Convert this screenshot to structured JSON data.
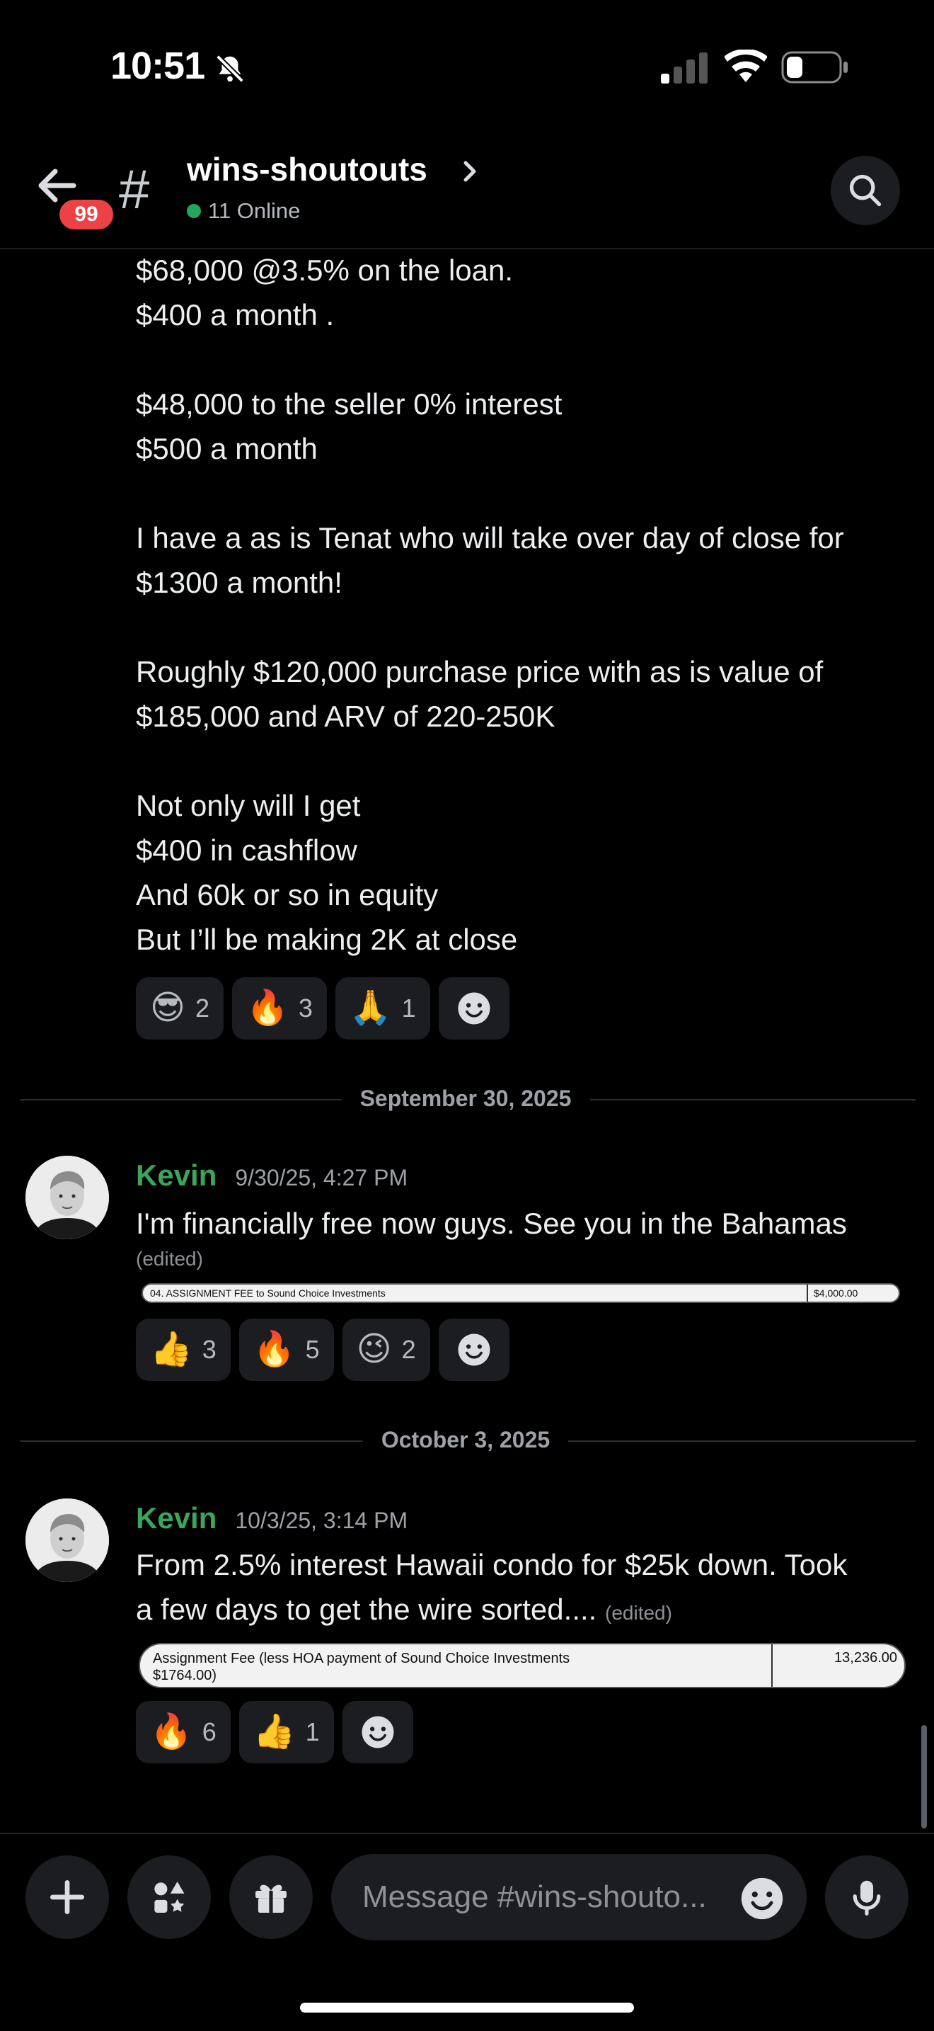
{
  "status_bar": {
    "time": "10:51"
  },
  "header": {
    "badge_count": "99",
    "channel_name": "wins-shoutouts",
    "online_text": "11 Online"
  },
  "message_prev": {
    "lines": [
      "$68,000 @3.5% on the loan.",
      "$400 a month .",
      "",
      "$48,000 to the seller 0% interest",
      "$500 a month",
      "",
      "I have a as is Tenat who will take over day of close for",
      "$1300 a month!",
      "",
      "Roughly $120,000 purchase price with as is value of",
      "$185,000 and ARV of 220-250K",
      "",
      "Not only will I get",
      "$400 in cashflow",
      "And 60k or so in equity",
      "But I’ll be making 2K at close"
    ],
    "reactions": [
      {
        "emoji": "😎",
        "count": "2"
      },
      {
        "emoji": "🔥",
        "count": "3"
      },
      {
        "emoji": "🙏",
        "count": "1"
      }
    ]
  },
  "divider_1": {
    "label": "September 30, 2025"
  },
  "message_1": {
    "author": "Kevin",
    "timestamp": "9/30/25, 4:27 PM",
    "text": "I'm financially free now guys.  See you in the Bahamas",
    "edited": "(edited)",
    "attachment": {
      "left": "04. ASSIGNMENT FEE to Sound Choice Investments",
      "right": "$4,000.00"
    },
    "reactions": [
      {
        "emoji": "👍",
        "count": "3"
      },
      {
        "emoji": "🔥",
        "count": "5"
      },
      {
        "emoji": "😉",
        "count": "2"
      }
    ]
  },
  "divider_2": {
    "label": "October 3, 2025"
  },
  "message_2": {
    "author": "Kevin",
    "timestamp": "10/3/25, 3:14 PM",
    "line1": "From 2.5% interest Hawaii condo for $25k down. Took",
    "line2": "a few days to get the wire sorted....",
    "edited": "(edited)",
    "attachment": {
      "left_line1": "Assignment Fee (less HOA payment of Sound Choice Investments",
      "left_line2": "$1764.00)",
      "right": "13,236.00"
    },
    "reactions": [
      {
        "emoji": "🔥",
        "count": "6"
      },
      {
        "emoji": "👍",
        "count": "1"
      }
    ]
  },
  "composer": {
    "placeholder": "Message #wins-shouto..."
  },
  "colors": {
    "accent_green": "#3ba55c",
    "badge_red": "#ed4245",
    "background": "#000000"
  }
}
